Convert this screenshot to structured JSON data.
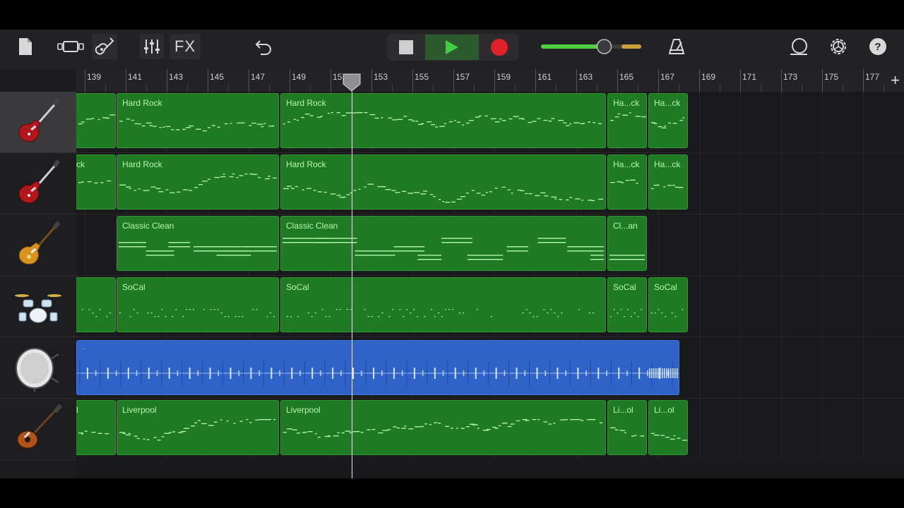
{
  "toolbar": {
    "fx_label": "FX",
    "volume_level": 0.63,
    "colors": {
      "accent_green": "#3fcf3f",
      "record_red": "#e0212a",
      "region_green": "#1e7a23",
      "audio_blue": "#2f63c8"
    }
  },
  "ruler": {
    "bars": [
      "139",
      "141",
      "143",
      "145",
      "147",
      "149",
      "151",
      "153",
      "155",
      "157",
      "159",
      "161",
      "163",
      "165",
      "167",
      "169",
      "171",
      "173",
      "175",
      "177"
    ]
  },
  "tracks": [
    {
      "instrument": "electric-guitar-red-icon",
      "selected": true,
      "regions": [
        {
          "label": ""
        },
        {
          "label": "Hard Rock"
        },
        {
          "label": "Hard Rock"
        },
        {
          "label": "Ha...ck"
        },
        {
          "label": "Ha...ck"
        }
      ]
    },
    {
      "instrument": "electric-guitar-red-icon",
      "selected": false,
      "regions": [
        {
          "label": "ck"
        },
        {
          "label": "Hard Rock"
        },
        {
          "label": "Hard Rock"
        },
        {
          "label": "Ha...ck"
        },
        {
          "label": "Ha...ck"
        }
      ]
    },
    {
      "instrument": "sunburst-guitar-icon",
      "selected": false,
      "regions": [
        {
          "label": "Classic Clean"
        },
        {
          "label": "Classic Clean"
        },
        {
          "label": "Cl...an"
        }
      ]
    },
    {
      "instrument": "drum-kit-icon",
      "selected": false,
      "regions": [
        {
          "label": ""
        },
        {
          "label": "SoCal"
        },
        {
          "label": "SoCal"
        },
        {
          "label": "SoCal"
        },
        {
          "label": "SoCal"
        }
      ]
    },
    {
      "instrument": "kick-drum-icon",
      "selected": false,
      "regions": [
        {
          "label": "··"
        }
      ]
    },
    {
      "instrument": "bass-guitar-icon",
      "selected": false,
      "regions": [
        {
          "label": "l"
        },
        {
          "label": "Liverpool"
        },
        {
          "label": "Liverpool"
        },
        {
          "label": "Li...ol"
        },
        {
          "label": "Li...ol"
        }
      ]
    }
  ]
}
